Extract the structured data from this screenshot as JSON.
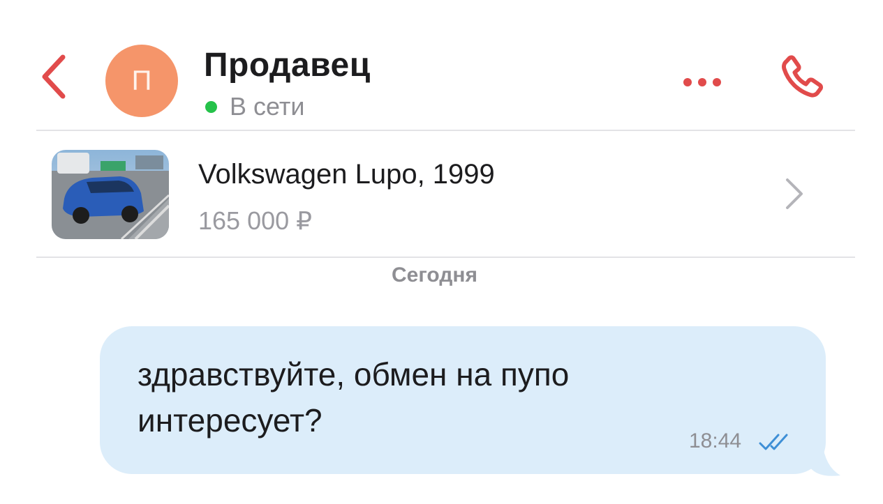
{
  "header": {
    "title": "Продавец",
    "avatar_letter": "П",
    "status": "В сети",
    "icons": {
      "back": "chevron-left-icon",
      "more": "more-dots-icon",
      "call": "phone-icon"
    }
  },
  "listing": {
    "title": "Volkswagen Lupo, 1999",
    "price": "165 000 ₽",
    "thumbnail": "car-photo",
    "chevron": "chevron-right-icon"
  },
  "chat": {
    "date_separator": "Сегодня",
    "messages": [
      {
        "text": "здравствуйте, обмен на пупо интересует?",
        "time": "18:44",
        "status_icon": "double-check-icon"
      }
    ]
  },
  "colors": {
    "accent": "#e14b4b",
    "avatar": "#f5956a",
    "online": "#25c24a",
    "bubble": "#dcedfa",
    "read_ticks": "#3e8fd6"
  }
}
